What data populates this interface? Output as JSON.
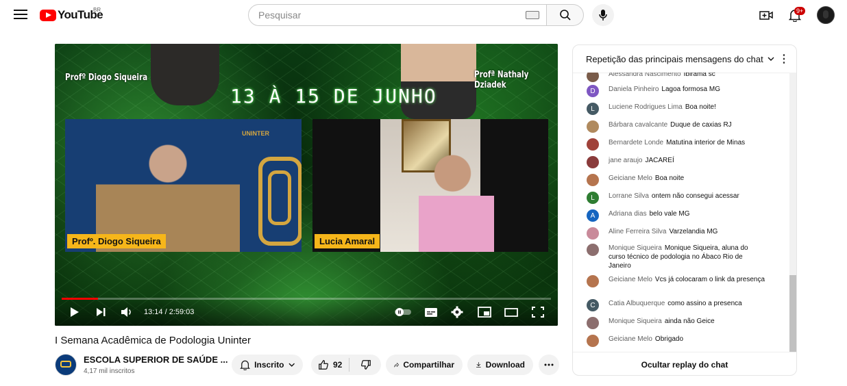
{
  "header": {
    "logo_text": "YouTube",
    "country_code": "BR",
    "search_placeholder": "Pesquisar",
    "notification_count": "9+"
  },
  "video": {
    "overlay_prof_left": "Profº Diogo Siqueira",
    "overlay_prof_right": "Profª Nathaly Dziadek",
    "overlay_date": "13 À 15 DE JUNHO",
    "overlay_brand": "UNINTER",
    "name_tag_1": "Profº. Diogo Siqueira",
    "name_tag_2": "Lucia Amaral",
    "time_display": "13:14 / 2:59:03",
    "progress_fraction": 0.074,
    "title": "I Semana Acadêmica de Podologia Uninter"
  },
  "channel": {
    "name": "ESCOLA SUPERIOR DE SAÚDE ...",
    "subscribers": "4,17 mil inscritos",
    "subscribe_label": "Inscrito"
  },
  "actions": {
    "like_count": "92",
    "share_label": "Compartilhar",
    "download_label": "Download"
  },
  "chat": {
    "header": "Repetição das principais mensagens do chat",
    "footer": "Ocultar replay do chat",
    "messages": [
      {
        "author": "Alessandra Nascimento",
        "text": "Ibirama sc",
        "avatar_color": "#7a5c4a",
        "avatar_letter": ""
      },
      {
        "author": "Daniela Pinheiro",
        "text": "Lagoa formosa MG",
        "avatar_color": "#7e57c2",
        "avatar_letter": "D"
      },
      {
        "author": "Luciene Rodrigues Lima",
        "text": "Boa noite!",
        "avatar_color": "#455a64",
        "avatar_letter": "L"
      },
      {
        "author": "Bárbara cavalcante",
        "text": "Duque de caxias RJ",
        "avatar_color": "#b08a5e",
        "avatar_letter": ""
      },
      {
        "author": "Bernardete Londe",
        "text": "Matutina interior de Minas",
        "avatar_color": "#a0423a",
        "avatar_letter": ""
      },
      {
        "author": "jane araujo",
        "text": "JACAREÍ",
        "avatar_color": "#8a3b3b",
        "avatar_letter": ""
      },
      {
        "author": "Geiciane Melo",
        "text": "Boa noite",
        "avatar_color": "#b5744e",
        "avatar_letter": ""
      },
      {
        "author": "Lorrane Silva",
        "text": "ontem não consegui acessar",
        "avatar_color": "#2e7d32",
        "avatar_letter": "L"
      },
      {
        "author": "Adriana dias",
        "text": "belo vale MG",
        "avatar_color": "#1565c0",
        "avatar_letter": "A"
      },
      {
        "author": "Aline Ferreira Silva",
        "text": "Varzelandia MG",
        "avatar_color": "#c98a9a",
        "avatar_letter": ""
      },
      {
        "author": "Monique Siqueira",
        "text": "Monique Siqueira, aluna do curso técnico de podologia no Ábaco Rio de Janeiro",
        "avatar_color": "#8c6e6e",
        "avatar_letter": ""
      },
      {
        "author": "Geiciane Melo",
        "text": "Vcs já colocaram o link da presença",
        "avatar_color": "#b5744e",
        "avatar_letter": ""
      },
      {
        "author": "Catia Albuquerque",
        "text": "como assino a presenca",
        "avatar_color": "#455a64",
        "avatar_letter": "C"
      },
      {
        "author": "Monique Siqueira",
        "text": "ainda não Geice",
        "avatar_color": "#8c6e6e",
        "avatar_letter": ""
      },
      {
        "author": "Geiciane Melo",
        "text": "Obrigado",
        "avatar_color": "#b5744e",
        "avatar_letter": ""
      }
    ]
  },
  "icons": [
    "menu-icon",
    "youtube-logo-icon",
    "keyboard-icon",
    "search-icon",
    "mic-icon",
    "create-icon",
    "bell-icon",
    "play-icon",
    "next-icon",
    "volume-icon",
    "autoplay-toggle-icon",
    "subtitles-icon",
    "settings-icon",
    "miniplayer-icon",
    "theater-icon",
    "fullscreen-icon",
    "bell-outline-icon",
    "thumb-up-icon",
    "thumb-down-icon",
    "share-icon",
    "download-icon",
    "more-icon",
    "chevron-down-icon",
    "kebab-icon"
  ]
}
